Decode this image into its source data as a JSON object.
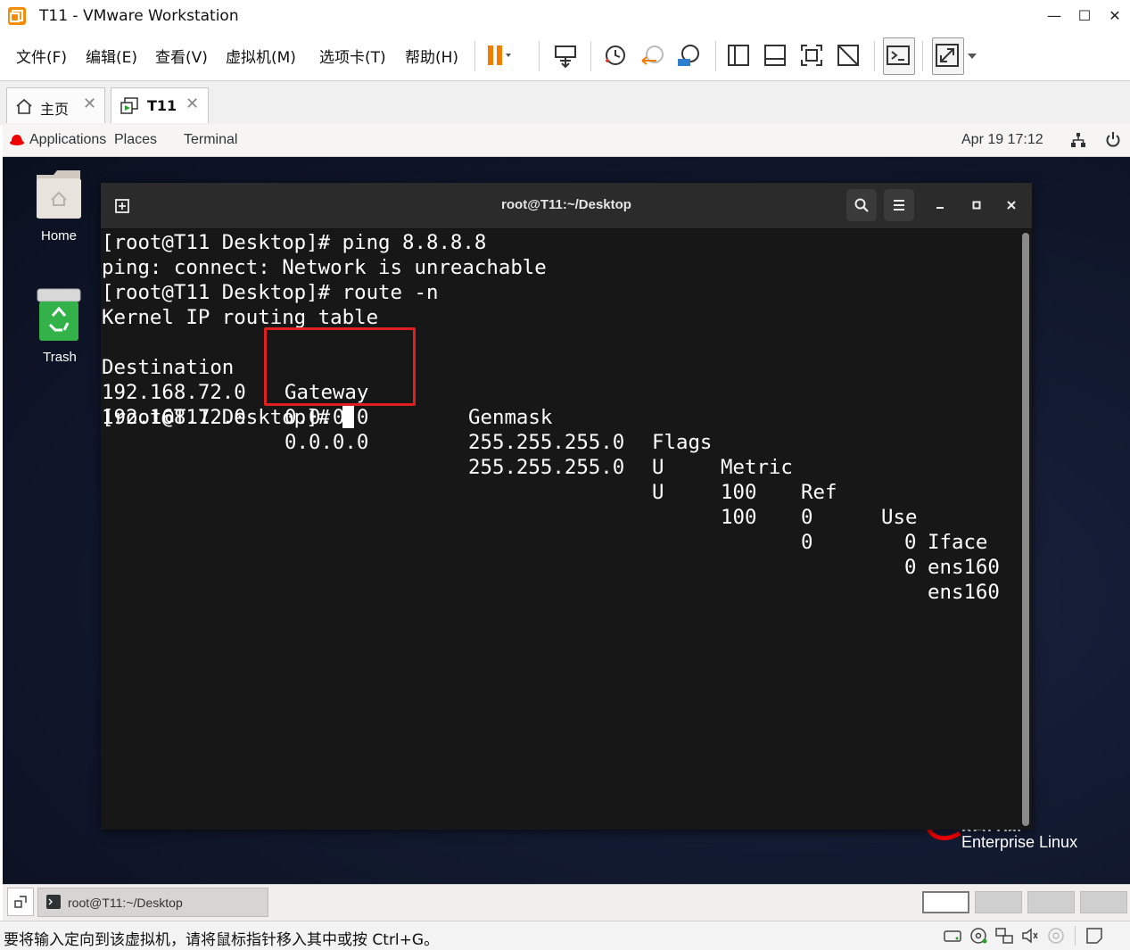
{
  "window": {
    "title": "T11 - VMware Workstation",
    "minimize": "—",
    "maximize": "☐",
    "close": "✕"
  },
  "menu": [
    "文件(F)",
    "编辑(E)",
    "查看(V)",
    "虚拟机(M)",
    "选项卡(T)",
    "帮助(H)"
  ],
  "tabs": [
    {
      "label": "主页",
      "close": "✕"
    },
    {
      "label": "T11",
      "close": "✕"
    }
  ],
  "guest_panel": {
    "applications": "Applications",
    "places": "Places",
    "terminal": "Terminal",
    "clock": "Apr 19  17:12"
  },
  "desktop": {
    "icons": [
      {
        "label": "Home"
      },
      {
        "label": "Trash"
      }
    ],
    "brand_line1": "Red Hat",
    "brand_line2": "Enterprise Linux"
  },
  "terminal": {
    "title": "root@T11:~/Desktop",
    "lines": [
      "[root@T11 Desktop]# ping 8.8.8.8",
      "ping: connect: Network is unreachable",
      "[root@T11 Desktop]# route -n",
      "Kernel IP routing table"
    ],
    "route_table": {
      "headers": [
        "Destination",
        "Gateway",
        "Genmask",
        "Flags",
        "Metric",
        "Ref",
        "Use",
        "Iface"
      ],
      "rows": [
        [
          "192.168.72.0",
          "0.0.0.0",
          "255.255.255.0",
          "U",
          "100",
          "0",
          "0",
          "ens160"
        ],
        [
          "192.168.72.0",
          "0.0.0.0",
          "255.255.255.0",
          "U",
          "100",
          "0",
          "0",
          "ens160"
        ]
      ]
    },
    "prompt": "[root@T11 Desktop]# "
  },
  "taskbar": {
    "window_label": "root@T11:~/Desktop"
  },
  "statusbar": {
    "text": "要将输入定向到该虚拟机，请将鼠标指针移入其中或按 Ctrl+G。"
  }
}
